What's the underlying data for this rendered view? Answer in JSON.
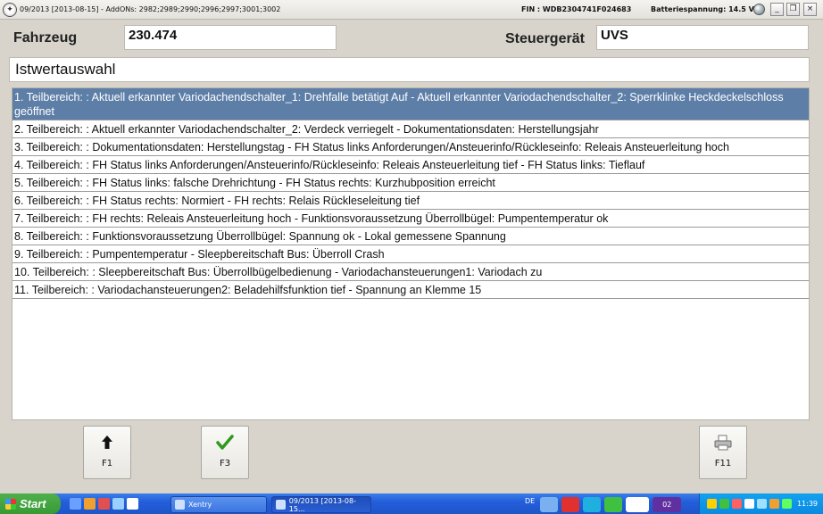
{
  "window": {
    "title": "09/2013 [2013-08-15] - AddONs: 2982;2989;2990;2996;2997;3001;3002",
    "fin": "FIN : WDB2304741F024683",
    "battery": "Batteriespannung: 14.5 V",
    "min_glyph": "_",
    "max_glyph": "❐",
    "close_glyph": "×"
  },
  "vehicle": {
    "fahrzeug_label": "Fahrzeug",
    "fahrzeug_value": "230.474",
    "steuergeraet_label": "Steuergerät",
    "steuergeraet_value": "UVS"
  },
  "section_title": "Istwertauswahl",
  "list": {
    "selected_index": 0,
    "items": [
      "1. Teilbereich: : Aktuell erkannter Variodachendschalter_1: Drehfalle betätigt Auf - Aktuell erkannter Variodachendschalter_2: Sperrklinke Heckdeckelschloss geöffnet",
      "2. Teilbereich: : Aktuell erkannter Variodachendschalter_2: Verdeck verriegelt - Dokumentationsdaten: Herstellungsjahr",
      "3. Teilbereich: : Dokumentationsdaten: Herstellungstag - FH Status links Anforderungen/Ansteuerinfo/Rückleseinfo: Releais Ansteuerleitung hoch",
      "4. Teilbereich: : FH Status links Anforderungen/Ansteuerinfo/Rückleseinfo: Releais Ansteuerleitung tief - FH Status links: Tieflauf",
      "5. Teilbereich: : FH Status links: falsche Drehrichtung - FH Status rechts: Kurzhubposition erreicht",
      "6. Teilbereich: : FH Status rechts: Normiert - FH rechts: Relais Rückleseleitung tief",
      "7. Teilbereich: : FH rechts: Releais Ansteuerleitung hoch - Funktionsvoraussetzung Überrollbügel: Pumpentemperatur ok",
      "8. Teilbereich: : Funktionsvoraussetzung Überrollbügel: Spannung ok - Lokal gemessene Spannung",
      "9. Teilbereich: : Pumpentemperatur - Sleepbereitschaft Bus: Überroll Crash",
      "10. Teilbereich: : Sleepbereitschaft Bus: Überrollbügelbedienung - Variodachansteuerungen1: Variodach zu",
      "11. Teilbereich: : Variodachansteuerungen2: Beladehilfsfunktion tief - Spannung an Klemme 15"
    ]
  },
  "function_keys": {
    "f1": {
      "key": "F1",
      "icon": "arrow-up-icon"
    },
    "f3": {
      "key": "F3",
      "icon": "checkmark-icon"
    },
    "f11": {
      "key": "F11",
      "icon": "printer-icon"
    }
  },
  "taskbar": {
    "start_label": "Start",
    "tasks": [
      "Xentry",
      "09/2013 [2013-08-15..."
    ],
    "lang": "DE",
    "badge": "02",
    "clock": "11:39"
  },
  "colors": {
    "selection": "#5d7ea6",
    "check": "#2e9a1e",
    "taskbar": "#245edb"
  }
}
